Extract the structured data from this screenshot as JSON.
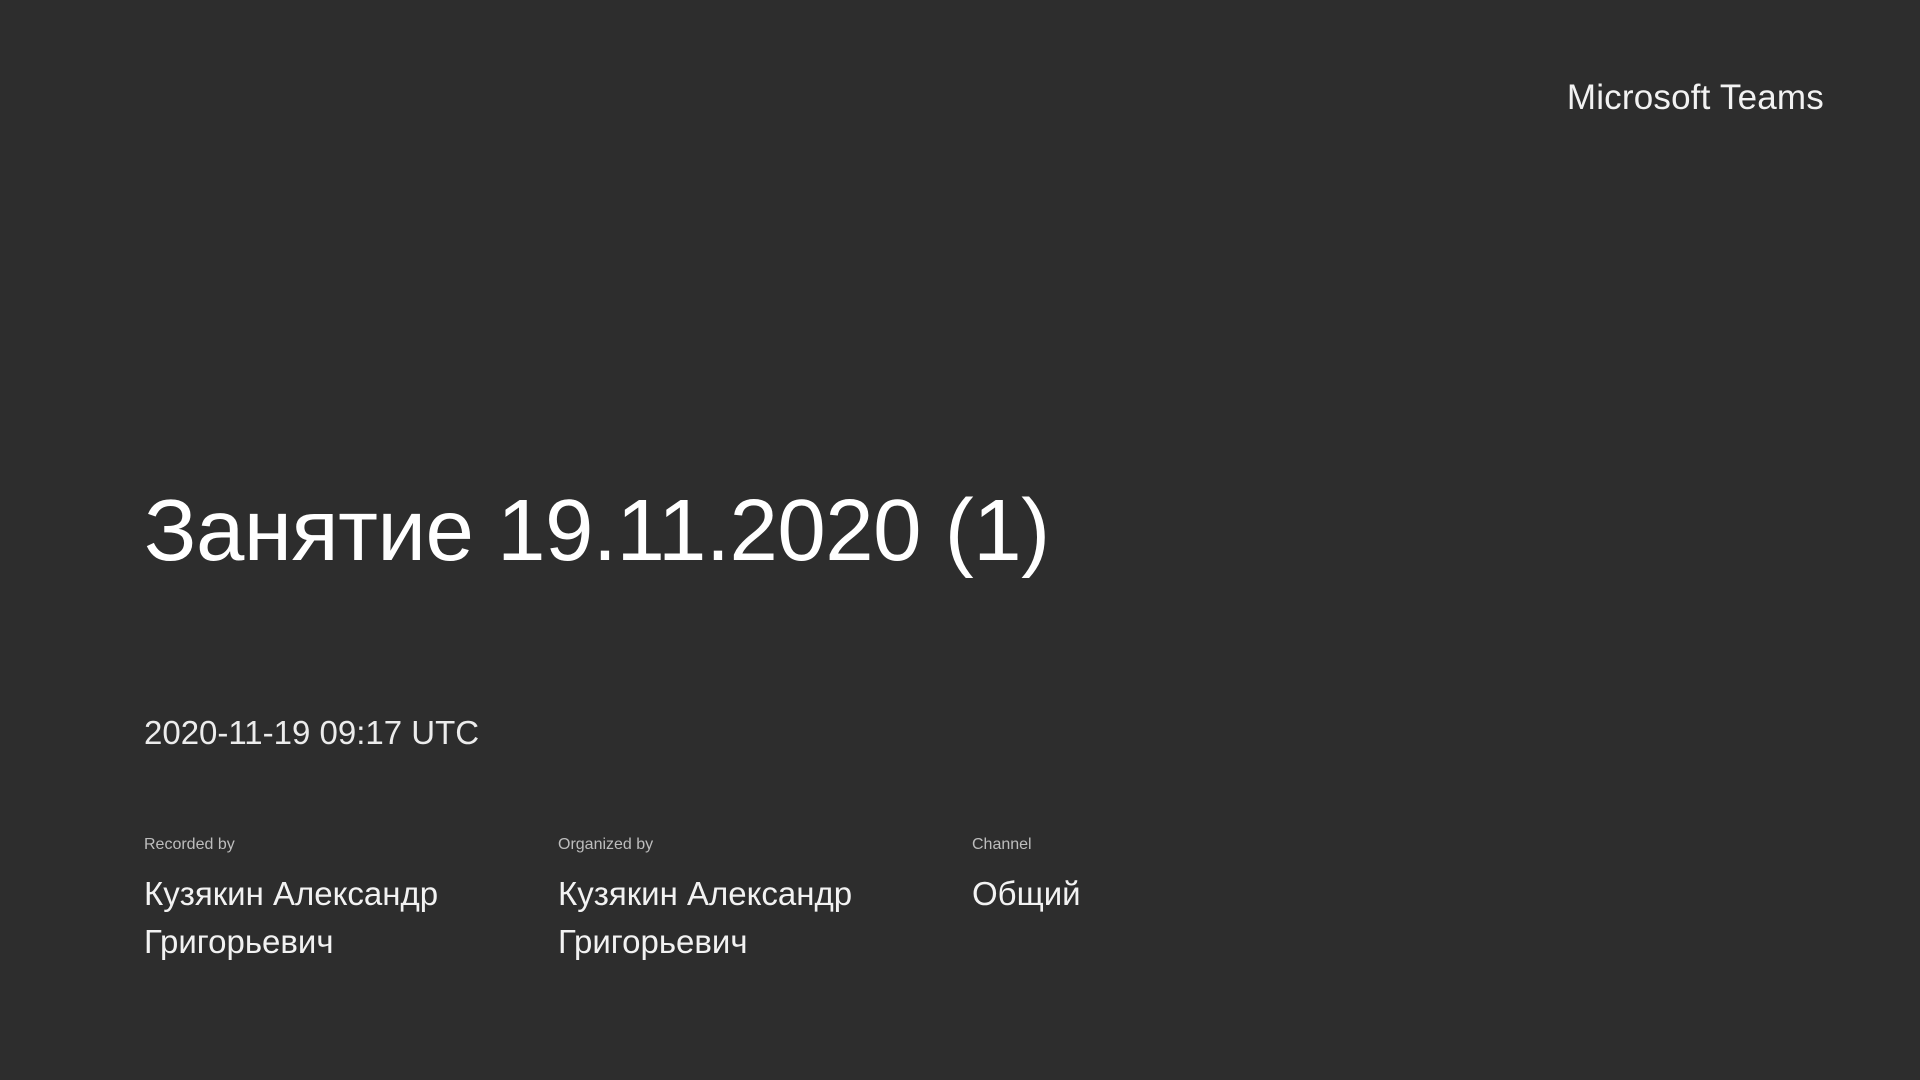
{
  "brand": "Microsoft Teams",
  "recording": {
    "title": "Занятие 19.11.2020 (1)",
    "datetime": "2020-11-19 09:17 UTC"
  },
  "meta": {
    "recorded_by": {
      "label": "Recorded by",
      "value": "Кузякин Александр Григорьевич"
    },
    "organized_by": {
      "label": "Organized by",
      "value": "Кузякин Александр Григорьевич"
    },
    "channel": {
      "label": "Channel",
      "value": "Общий"
    }
  }
}
